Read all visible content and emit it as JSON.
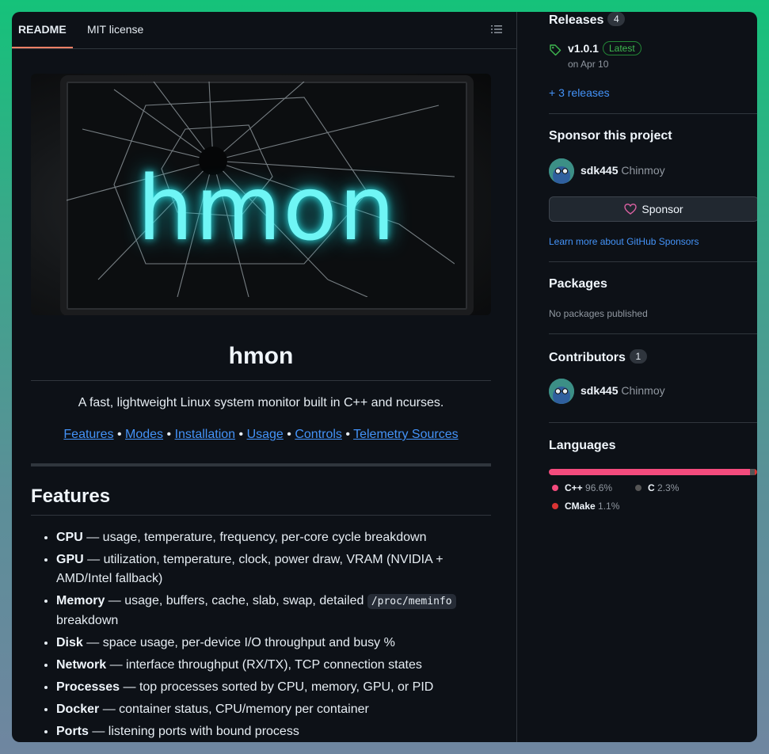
{
  "tabs": {
    "readme": "README",
    "license": "MIT license"
  },
  "hero": {
    "image_text": "hmon"
  },
  "repo": {
    "title": "hmon",
    "tagline": "A fast, lightweight Linux system monitor built in C++ and ncurses.",
    "nav": [
      "Features",
      "Modes",
      "Installation",
      "Usage",
      "Controls",
      "Telemetry Sources"
    ],
    "separator": " • "
  },
  "features": {
    "heading": "Features",
    "items": [
      {
        "name": "CPU",
        "desc": " — usage, temperature, frequency, per-core cycle breakdown"
      },
      {
        "name": "GPU",
        "desc": " — utilization, temperature, clock, power draw, VRAM (NVIDIA + AMD/Intel fallback)"
      },
      {
        "name": "Memory",
        "desc": " — usage, buffers, cache, slab, swap, detailed ",
        "code": "/proc/meminfo",
        "desc2": " breakdown"
      },
      {
        "name": "Disk",
        "desc": " — space usage, per-device I/O throughput and busy %"
      },
      {
        "name": "Network",
        "desc": " — interface throughput (RX/TX), TCP connection states"
      },
      {
        "name": "Processes",
        "desc": " — top processes sorted by CPU, memory, GPU, or PID"
      },
      {
        "name": "Docker",
        "desc": " — container status, CPU/memory per container"
      },
      {
        "name": "Ports",
        "desc": " — listening ports with bound process"
      }
    ]
  },
  "sidebar": {
    "releases": {
      "heading": "Releases",
      "count": "4",
      "version": "v1.0.1",
      "latest": "Latest",
      "date": "on Apr 10",
      "more": "+ 3 releases"
    },
    "sponsor": {
      "heading": "Sponsor this project",
      "user": "sdk445",
      "fullname": "Chinmoy",
      "button": "Sponsor",
      "learn": "Learn more about GitHub Sponsors"
    },
    "packages": {
      "heading": "Packages",
      "none": "No packages published"
    },
    "contributors": {
      "heading": "Contributors",
      "count": "1",
      "user": "sdk445",
      "fullname": "Chinmoy"
    },
    "languages": {
      "heading": "Languages",
      "items": [
        {
          "name": "C++",
          "percent": "96.6%",
          "value": 96.6,
          "color": "#f34b7d"
        },
        {
          "name": "C",
          "percent": "2.3%",
          "value": 2.3,
          "color": "#555555"
        },
        {
          "name": "CMake",
          "percent": "1.1%",
          "value": 1.1,
          "color": "#da3434"
        }
      ]
    }
  },
  "colors": {
    "accent": "#4493f8",
    "tab_underline": "#f78166",
    "latest": "#3fb950",
    "sponsor_heart": "#db61a2"
  },
  "icons": [
    "toc-list-icon",
    "tag-icon",
    "heart-icon",
    "avatar"
  ]
}
